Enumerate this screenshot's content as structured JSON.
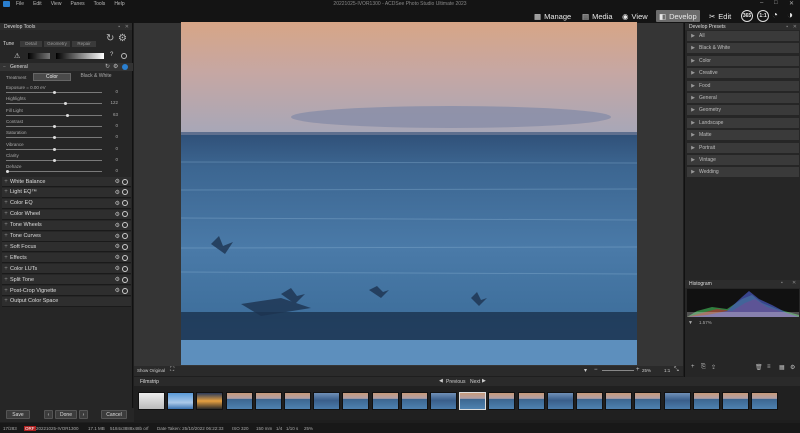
{
  "titlebar": {
    "menus": [
      "File",
      "Edit",
      "View",
      "Panes",
      "Tools",
      "Help"
    ],
    "title": "20221025-IVOR1300 - ACDSee Photo Studio Ultimate 2023"
  },
  "modes": {
    "manage": "Manage",
    "media": "Media",
    "view": "View",
    "develop": "Develop",
    "edit": "Edit"
  },
  "modeicons": {
    "a": "365",
    "b": "1:1"
  },
  "leftpanel": {
    "title": "Develop Tools",
    "tabs": [
      "Tune",
      "Detail",
      "Geometry",
      "Repair"
    ],
    "general": "General",
    "treatment_label": "Treatment",
    "treatment_color": "Color",
    "treatment_bw": "Black & White",
    "sliders": [
      {
        "label": "Exposure = 0.00 eV",
        "value": "0",
        "pos": 0.5
      },
      {
        "label": "Highlights",
        "value": "122",
        "pos": 0.62
      },
      {
        "label": "Fill Light",
        "value": "63",
        "pos": 0.64
      },
      {
        "label": "Contrast",
        "value": "0",
        "pos": 0.5
      },
      {
        "label": "Saturation",
        "value": "0",
        "pos": 0.5
      },
      {
        "label": "Vibrance",
        "value": "0",
        "pos": 0.5
      },
      {
        "label": "Clarity",
        "value": "0",
        "pos": 0.5
      },
      {
        "label": "Dehaze",
        "value": "0",
        "pos": 0.0
      }
    ],
    "sections": [
      "White Balance",
      "Light EQ™",
      "Color EQ",
      "Color Wheel",
      "Tone Wheels",
      "Tone Curves",
      "Soft Focus",
      "Effects",
      "Color LUTs",
      "Split Tone",
      "Post-Crop Vignette",
      "Output Color Space"
    ]
  },
  "viewbar": {
    "show_original": "Show Original",
    "zoom": "25%",
    "ratio": "1:1"
  },
  "rightpanel": {
    "title": "Develop Presets",
    "presets": [
      "All",
      "Black & White",
      "Color",
      "Creative",
      "Food",
      "General",
      "Geometry",
      "Landscape",
      "Matte",
      "Portrait",
      "Vintage",
      "Wedding"
    ]
  },
  "histogram": {
    "title": "Histogram",
    "value": "1.57%"
  },
  "filmstrip": {
    "title": "Filmstrip",
    "previous": "Previous",
    "next": "Next"
  },
  "bottom": {
    "save": "Save",
    "done": "Done",
    "cancel": "Cancel"
  },
  "status": {
    "count": "17/283",
    "format": "ORF",
    "filename": "20221025-IVOR1300",
    "size": "17.1 MB",
    "dims": "5184x3888x48b orf",
    "date": "Date Taken: 25/10/2022 06:22:33",
    "iso": "ISO 320",
    "focal": "150 mm",
    "fstop": "1/4",
    "shutter": "1/10 s",
    "zoom": "25%"
  },
  "colors": {
    "accent": "#2a7fd0",
    "sky_top": "#dba382",
    "sea": "#3f6f9c"
  }
}
